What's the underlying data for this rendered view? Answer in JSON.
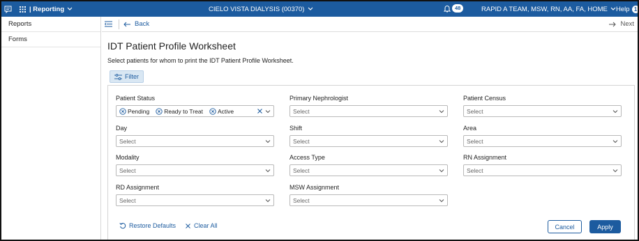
{
  "topbar": {
    "app_name": "| Reporting",
    "facility": "CIELO VISTA DIALYSIS (00370)",
    "notification_count": "48",
    "user": "RAPID A TEAM, MSW, RN, AA, FA, HOME",
    "help_label": "Help",
    "help_count": "1",
    "brand_color": "#1c5b9f"
  },
  "sidebar": {
    "items": [
      {
        "label": "Reports"
      },
      {
        "label": "Forms"
      }
    ]
  },
  "nav": {
    "back_label": "Back",
    "next_label": "Next"
  },
  "page": {
    "title": "IDT Patient Profile Worksheet",
    "subtitle": "Select patients for whom to print the IDT Patient Profile Worksheet.",
    "filter_label": "Filter"
  },
  "filters": {
    "patient_status": {
      "label": "Patient Status",
      "chips": [
        "Pending",
        "Ready to Treat",
        "Active"
      ]
    },
    "primary_nephrologist": {
      "label": "Primary Nephrologist",
      "placeholder": "Select"
    },
    "patient_census": {
      "label": "Patient Census",
      "placeholder": "Select"
    },
    "day": {
      "label": "Day",
      "placeholder": "Select"
    },
    "shift": {
      "label": "Shift",
      "placeholder": "Select"
    },
    "area": {
      "label": "Area",
      "placeholder": "Select"
    },
    "modality": {
      "label": "Modality",
      "placeholder": "Select"
    },
    "access_type": {
      "label": "Access Type",
      "placeholder": "Select"
    },
    "rn_assignment": {
      "label": "RN Assignment",
      "placeholder": "Select"
    },
    "rd_assignment": {
      "label": "RD Assignment",
      "placeholder": "Select"
    },
    "msw_assignment": {
      "label": "MSW Assignment",
      "placeholder": "Select"
    }
  },
  "footer": {
    "restore_label": "Restore Defaults",
    "clear_label": "Clear All",
    "cancel_label": "Cancel",
    "apply_label": "Apply"
  }
}
